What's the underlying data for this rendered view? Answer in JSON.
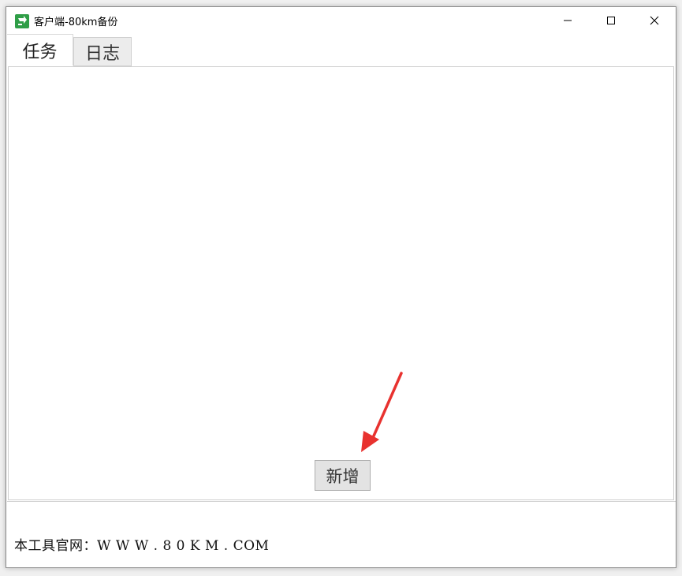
{
  "window": {
    "title": "客户端-80km备份"
  },
  "titlebar_icons": {
    "app": "app-logo-icon",
    "minimize": "minimize-icon",
    "maximize": "maximize-icon",
    "close": "close-icon"
  },
  "tabs": [
    {
      "label": "任务",
      "active": true
    },
    {
      "label": "日志",
      "active": false
    }
  ],
  "task_panel": {
    "add_button_label": "新增"
  },
  "footer": {
    "text": "本工具官网：W W W . 8 0 K M . COM"
  },
  "annotation": {
    "arrow_color": "#e8322f"
  }
}
